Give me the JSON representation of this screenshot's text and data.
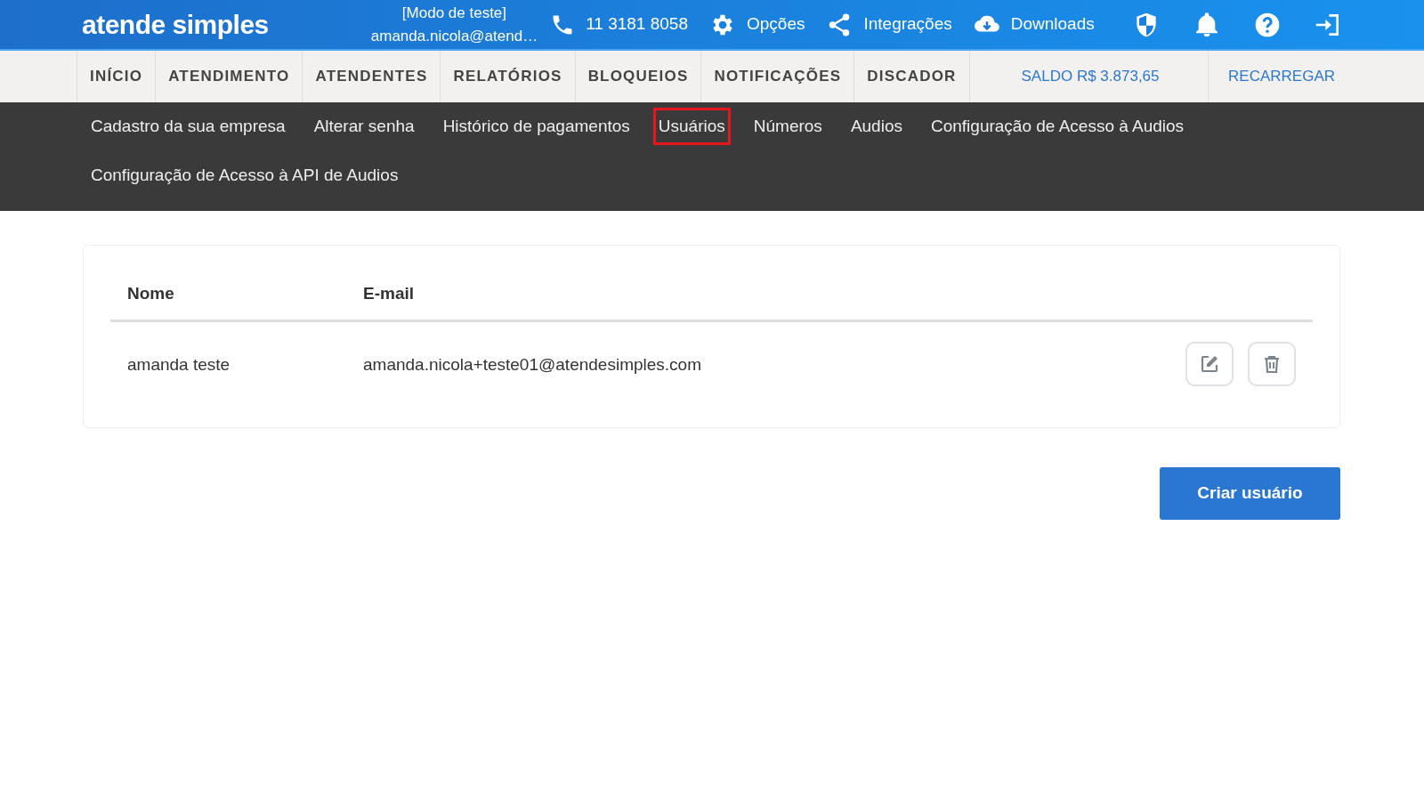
{
  "header": {
    "logo": "atende simples",
    "mode": "[Modo de teste]",
    "user": "amanda.nicola@atend…",
    "phone": "11 3181 8058",
    "links": [
      {
        "kind": "options",
        "label": "Opções"
      },
      {
        "kind": "integrations",
        "label": "Integrações"
      },
      {
        "kind": "downloads",
        "label": "Downloads"
      }
    ],
    "icons": [
      {
        "kind": "shield"
      },
      {
        "kind": "bell"
      },
      {
        "kind": "help"
      },
      {
        "kind": "logout"
      }
    ]
  },
  "main_nav": {
    "items": [
      {
        "label": "INÍCIO"
      },
      {
        "label": "ATENDIMENTO"
      },
      {
        "label": "ATENDENTES"
      },
      {
        "label": "RELATÓRIOS"
      },
      {
        "label": "BLOQUEIOS"
      },
      {
        "label": "NOTIFICAÇÕES"
      },
      {
        "label": "DISCADOR"
      }
    ],
    "balance": "SALDO R$ 3.873,65",
    "recharge": "RECARREGAR"
  },
  "sub_nav": {
    "items": [
      {
        "label": "Cadastro da sua empresa",
        "selected": false
      },
      {
        "label": "Alterar senha",
        "selected": false
      },
      {
        "label": "Histórico de pagamentos",
        "selected": false
      },
      {
        "label": "Usuários",
        "selected": true
      },
      {
        "label": "Números",
        "selected": false
      },
      {
        "label": "Audios",
        "selected": false
      },
      {
        "label": "Configuração de Acesso à Audios",
        "selected": false
      },
      {
        "label": "Configuração de Acesso à API de Audios",
        "selected": false
      }
    ]
  },
  "table": {
    "columns": [
      "Nome",
      "E-mail"
    ],
    "rows": [
      {
        "name": "amanda teste",
        "email": "amanda.nicola+teste01@atendesimples.com"
      }
    ]
  },
  "create_button": "Criar usuário"
}
